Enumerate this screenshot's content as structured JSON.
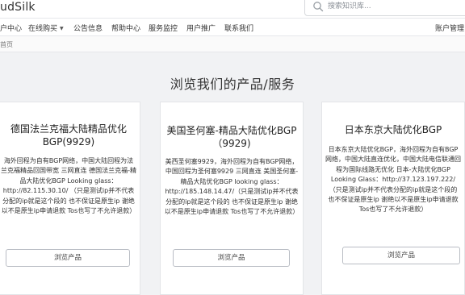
{
  "header": {
    "brand": "udSilk",
    "search_placeholder": "搜索知识库...",
    "search_icon": "search-icon"
  },
  "nav": {
    "items": [
      "户中心",
      "在线购买",
      "公告信息",
      "帮助中心",
      "服务监控",
      "用户推广",
      "联系我们"
    ],
    "right": "账户管理"
  },
  "breadcrumb": "首页",
  "page_title": "浏览我们的产品/服务",
  "products": [
    {
      "title": "德国法兰克福大陆精品优化BGP(9929)",
      "description": "海外回程为自有BGP网络，中国大陆回程为法兰克福精品回国带宽 三网直连 德国法兰克福-精品大陆优化BGP Looking glass：http://82.115.30.10/ （只是测试ip并不代表分配的ip就是这个段的 也不保证是原生ip 谢绝以不是原生ip申请退款 Tos也写了不允许退款）",
      "button": "浏览产品"
    },
    {
      "title": "美国圣何塞-精品大陆优化BGP（9929)",
      "description": "美西圣何塞9929，海外回程为自有BGP网络，中国回程为圣何塞9929 三网直连 美国圣何塞-精品大陆优化BGP looking glass：http://185.148.14.47/（只是测试ip并不代表分配的ip就是这个段的 也不保证是原生ip 谢绝以不是原生ip申请退款 Tos也写了不允许退款）",
      "button": "浏览产品"
    },
    {
      "title": "日本东京大陆优化BGP",
      "description": "日本东京大陆优化BGP，海外回程为自有BGP网络，中国大陆直连优化，中国大陆电信联通回程为国际线路无优化 日本-大陆优化BGP Looking Glass：http://37.123.197.222/ （只是测试ip并不代表分配的ip就是这个段的 也不保证是原生ip 谢绝以不是原生ip申请退款 Tos也写了不允许退款）",
      "button": "浏览产品"
    }
  ]
}
